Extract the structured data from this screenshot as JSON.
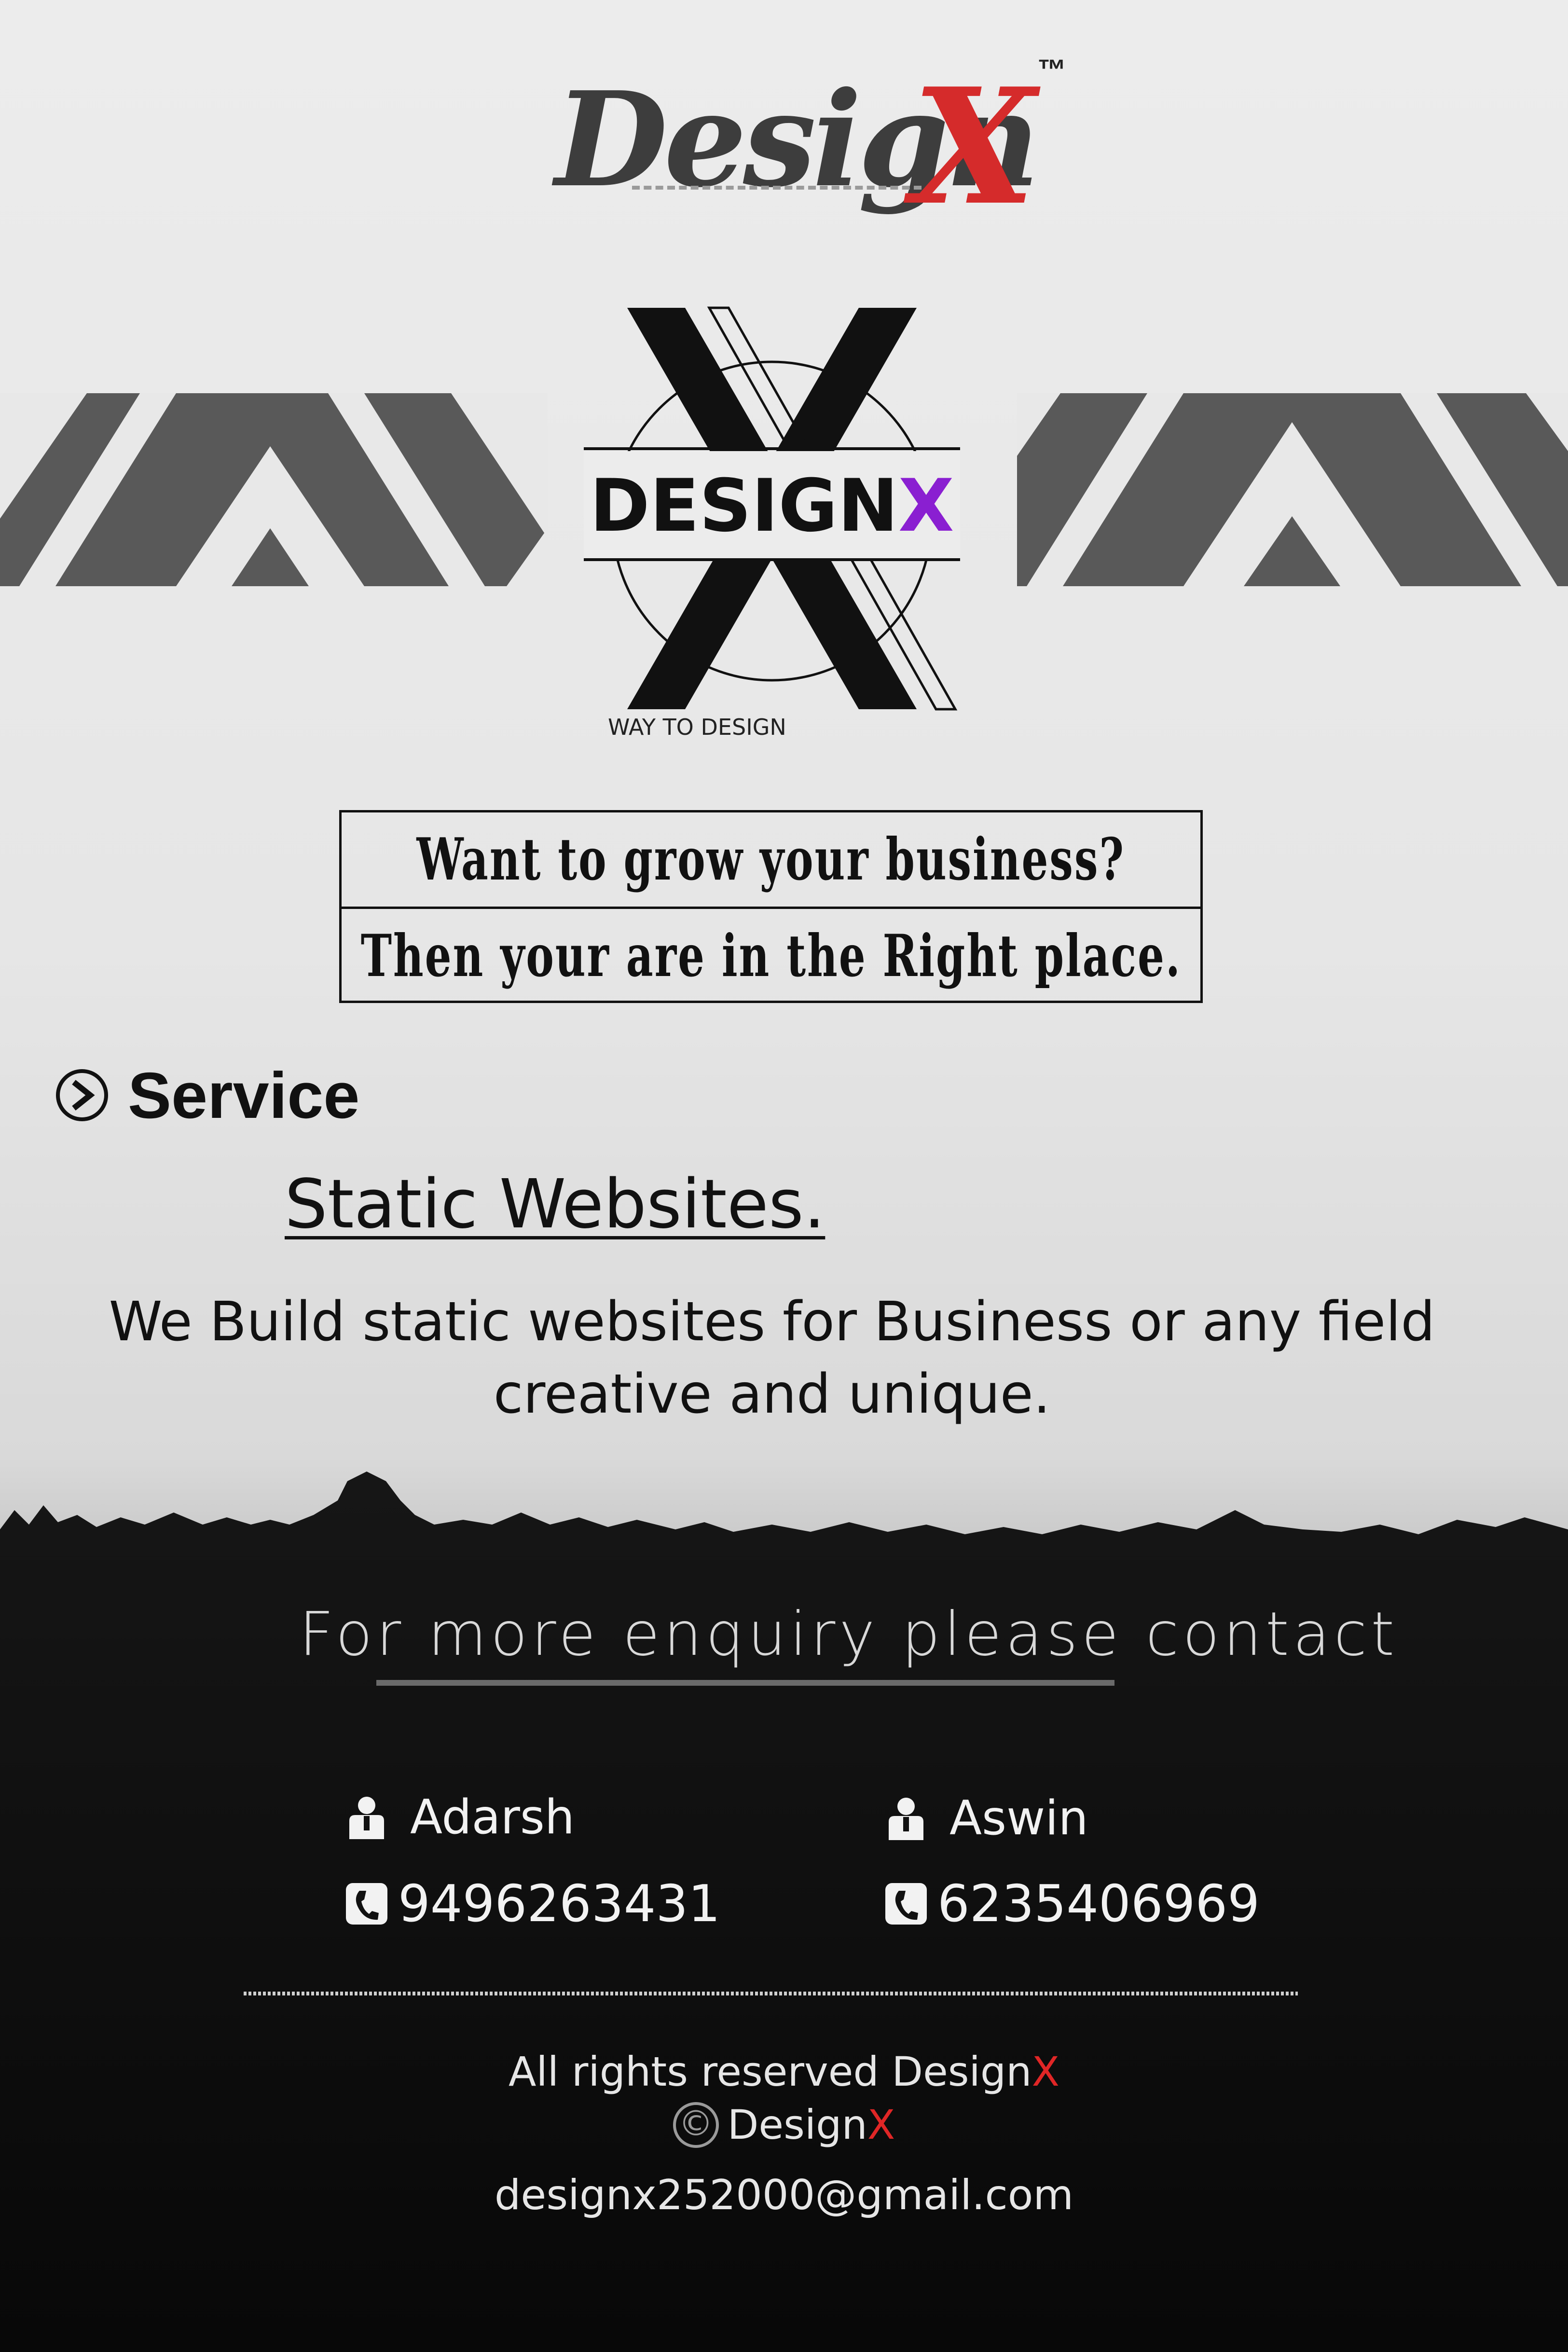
{
  "logo": {
    "word": "Design",
    "accent_letter": "X",
    "trademark": "™"
  },
  "emblem": {
    "brand_main": "DESIGN",
    "brand_accent": "X",
    "tagline": "WAY TO DESIGN"
  },
  "headline": {
    "line1": "Want to grow your business?",
    "line2": "Then your are in the Right place."
  },
  "service": {
    "heading": "Service",
    "name": "Static Websites.",
    "description_line1": "We Build static websites for Business or any field",
    "description_line2": "creative and unique."
  },
  "contact": {
    "prompt": "For more enquiry please contact",
    "people": [
      {
        "name": "Adarsh",
        "phone": "9496263431"
      },
      {
        "name": "Aswin",
        "phone": "6235406969"
      }
    ]
  },
  "footer": {
    "rights_prefix": "All rights reserved Design",
    "rights_accent": "X",
    "copyright_symbol": "©",
    "copyright_prefix": "Design",
    "copyright_accent": "X",
    "email": "designx252000@gmail.com"
  },
  "colors": {
    "accent_red": "#d52b2b",
    "accent_purple": "#8a1fd1",
    "band_gray": "#595959",
    "dark": "#111111"
  },
  "icons": [
    "arrow-right-circle-icon",
    "person-icon",
    "phone-icon",
    "copyright-icon"
  ]
}
